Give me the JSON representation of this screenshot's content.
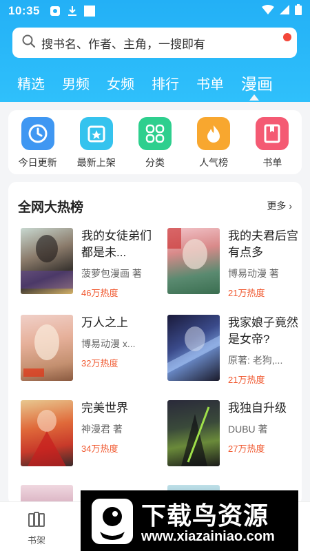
{
  "status": {
    "time": "10:35"
  },
  "search": {
    "placeholder": "搜书名、作者、主角，一搜即有"
  },
  "tabs": [
    "精选",
    "男频",
    "女频",
    "排行",
    "书单",
    "漫画"
  ],
  "active_tab": "漫画",
  "quick": [
    {
      "label": "今日更新",
      "icon": "clock-icon",
      "color": "#3f97f2"
    },
    {
      "label": "最新上架",
      "icon": "star-box-icon",
      "color": "#35c3ee"
    },
    {
      "label": "分类",
      "icon": "grid-icon",
      "color": "#2ecf8e"
    },
    {
      "label": "人气榜",
      "icon": "fire-icon",
      "color": "#f8a72f"
    },
    {
      "label": "书单",
      "icon": "bookmark-book-icon",
      "color": "#f45a73"
    }
  ],
  "panel": {
    "title": "全网大热榜",
    "more": "更多",
    "books": [
      {
        "title": "我的女徒弟们都是未...",
        "author": "菠萝包漫画 著",
        "heat": "46万热度"
      },
      {
        "title": "我的夫君后宫有点多",
        "author": "博易动漫 著",
        "heat": "21万热度"
      },
      {
        "title": "万人之上",
        "author": "博易动漫 x...",
        "heat": "32万热度"
      },
      {
        "title": "我家娘子竟然是女帝?",
        "author": "原著: 老狗,...",
        "heat": "21万热度"
      },
      {
        "title": "完美世界",
        "author": "神漫君 著",
        "heat": "34万热度"
      },
      {
        "title": "我独自升级",
        "author": "DUBU 著",
        "heat": "27万热度"
      }
    ]
  },
  "bottom": {
    "shelf": "书架"
  },
  "banner": {
    "title": "下载鸟资源",
    "url": "www.xiazainiao.com"
  },
  "colors": {
    "accent": "#23b0f6",
    "heat": "#f0582f"
  }
}
